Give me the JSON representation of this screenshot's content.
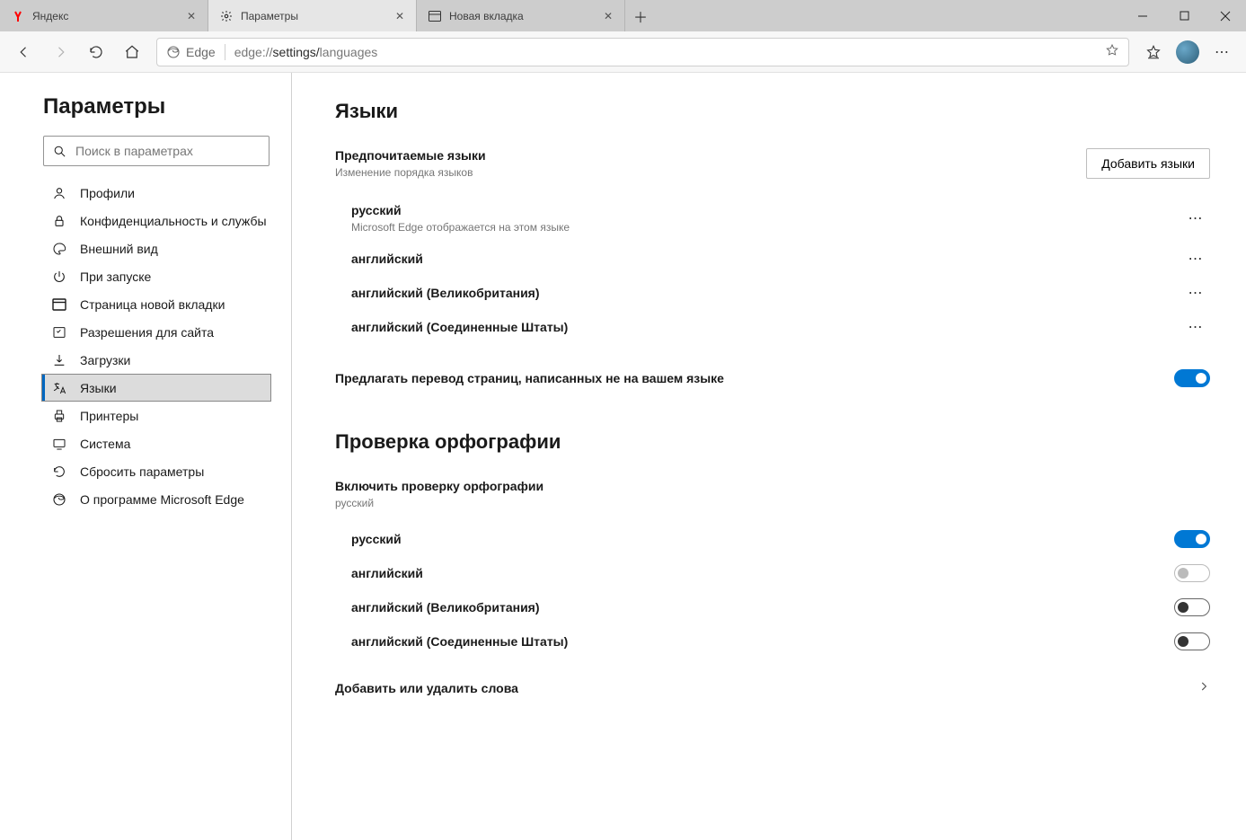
{
  "tabs": [
    {
      "title": "Яндекс",
      "icon": "yandex"
    },
    {
      "title": "Параметры",
      "icon": "gear"
    },
    {
      "title": "Новая вкладка",
      "icon": "newtab"
    }
  ],
  "address": {
    "chip": "Edge",
    "url_prefix": "edge://",
    "url_mid": "settings/",
    "url_tail": "languages"
  },
  "sidebar": {
    "title": "Параметры",
    "search_placeholder": "Поиск в параметрах",
    "items": [
      "Профили",
      "Конфиденциальность и службы",
      "Внешний вид",
      "При запуске",
      "Страница новой вкладки",
      "Разрешения для сайта",
      "Загрузки",
      "Языки",
      "Принтеры",
      "Система",
      "Сбросить параметры",
      "О программе Microsoft Edge"
    ],
    "active_index": 7
  },
  "main": {
    "languages_title": "Языки",
    "preferred": {
      "heading": "Предпочитаемые языки",
      "sub": "Изменение порядка языков",
      "add_button": "Добавить языки",
      "items": [
        {
          "name": "русский",
          "note": "Microsoft Edge отображается на этом языке"
        },
        {
          "name": "английский"
        },
        {
          "name": "английский (Великобритания)"
        },
        {
          "name": "английский (Соединенные Штаты)"
        }
      ]
    },
    "translate_label": "Предлагать перевод страниц, написанных не на вашем языке",
    "translate_on": true,
    "spell_title": "Проверка орфографии",
    "spell_enable_label": "Включить проверку орфографии",
    "spell_enable_sub": "русский",
    "spell_langs": [
      {
        "name": "русский",
        "state": "on"
      },
      {
        "name": "английский",
        "state": "disabled"
      },
      {
        "name": "английский (Великобритания)",
        "state": "off"
      },
      {
        "name": "английский (Соединенные Штаты)",
        "state": "off"
      }
    ],
    "add_remove_words": "Добавить или удалить слова"
  }
}
